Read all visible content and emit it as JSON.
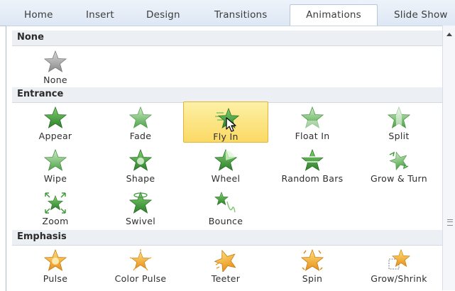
{
  "ribbon": {
    "tabs": [
      {
        "label": "Home"
      },
      {
        "label": "Insert"
      },
      {
        "label": "Design"
      },
      {
        "label": "Transitions"
      },
      {
        "label": "Animations",
        "active": true
      },
      {
        "label": "Slide Show"
      }
    ]
  },
  "gallery": {
    "sections": [
      {
        "title": "None",
        "items": [
          {
            "label": "None",
            "icon": "star-none-icon"
          }
        ]
      },
      {
        "title": "Entrance",
        "items": [
          {
            "label": "Appear",
            "icon": "appear-star-icon"
          },
          {
            "label": "Fade",
            "icon": "fade-star-icon"
          },
          {
            "label": "Fly In",
            "icon": "fly-in-star-icon",
            "selected": true
          },
          {
            "label": "Float In",
            "icon": "float-in-star-icon"
          },
          {
            "label": "Split",
            "icon": "split-star-icon"
          },
          {
            "label": "Wipe",
            "icon": "wipe-star-icon"
          },
          {
            "label": "Shape",
            "icon": "shape-star-icon"
          },
          {
            "label": "Wheel",
            "icon": "wheel-star-icon"
          },
          {
            "label": "Random Bars",
            "icon": "random-bars-star-icon"
          },
          {
            "label": "Grow & Turn",
            "icon": "grow-turn-star-icon"
          },
          {
            "label": "Zoom",
            "icon": "zoom-star-icon"
          },
          {
            "label": "Swivel",
            "icon": "swivel-star-icon"
          },
          {
            "label": "Bounce",
            "icon": "bounce-star-icon"
          }
        ]
      },
      {
        "title": "Emphasis",
        "items": [
          {
            "label": "Pulse",
            "icon": "pulse-star-icon"
          },
          {
            "label": "Color Pulse",
            "icon": "color-pulse-star-icon"
          },
          {
            "label": "Teeter",
            "icon": "teeter-star-icon"
          },
          {
            "label": "Spin",
            "icon": "spin-star-icon"
          },
          {
            "label": "Grow/Shrink",
            "icon": "grow-shrink-star-icon"
          }
        ]
      }
    ]
  },
  "colors": {
    "entrance_green": "#3e9c3a",
    "emphasis_gold": "#f2a623",
    "none_gray": "#9a9a9a",
    "selection": "#fbd964"
  }
}
